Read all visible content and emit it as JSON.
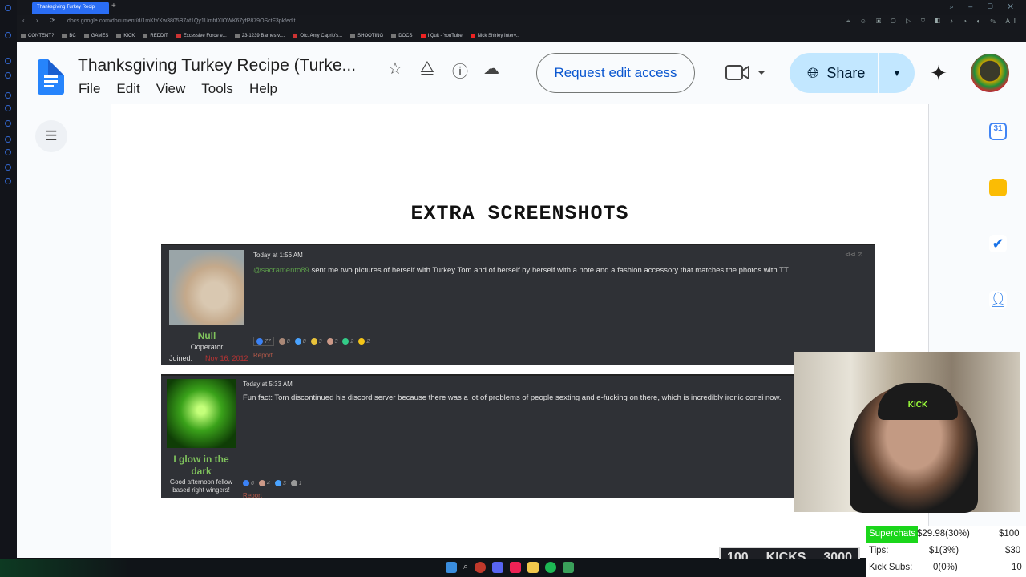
{
  "browser": {
    "tab_title": "Thanksgiving Turkey Recip",
    "url": "docs.google.com/document/d/1mKfYKw3805B7af1Qy1UmfdXlOWK67yfP879OSctF3pk/edit",
    "bookmarks": [
      "CONTENT?",
      "BC",
      "GAMES",
      "KICK",
      "REDDIT",
      "Excessive Force e...",
      "23-1239 Barnes v....",
      "Ofc. Amy Caprio's...",
      "SHOOTING",
      "DOCS",
      "I Quit - YouTube",
      "Nick Shirley Interv..."
    ]
  },
  "docs": {
    "title": "Thanksgiving Turkey Recipe (Turke...",
    "menu": [
      "File",
      "Edit",
      "View",
      "Tools",
      "Help"
    ],
    "request_edit": "Request edit access",
    "share": "Share",
    "heading": "EXTRA SCREENSHOTS"
  },
  "posts": [
    {
      "timestamp": "Today at 1:56 AM",
      "mention": "@sacramento89",
      "text": " sent me two pictures of herself with Turkey Tom and of herself by herself with a note and a fashion accessory that matches the photos with TT.",
      "username": "Null",
      "role": "Ooperator",
      "joined_label": "Joined:",
      "joined_date": "Nov 16, 2012",
      "report": "Report",
      "reactions": [
        "77",
        "8",
        "8",
        "3",
        "3",
        "2",
        "2"
      ]
    },
    {
      "timestamp": "Today at 5:33 AM",
      "text": "Fun fact: Tom discontinued his discord server because there was a lot of problems of people sexting and e-fucking on there, which is incredibly ironic consi now.",
      "username": "I glow in the dark",
      "role": "Good afternoon fellow based right wingers!",
      "report": "Report",
      "reactions": [
        "6",
        "4",
        "3",
        "1"
      ]
    }
  ],
  "webcam": {
    "hat_text": "KICK"
  },
  "overlay": {
    "kicks_low": "100",
    "kicks_label": "KICKS",
    "kicks_high": "3000",
    "stats": [
      {
        "label": "Superchats",
        "value": "$29.98(30%)",
        "goal": "$100"
      },
      {
        "label": "Tips:",
        "value": "$1(3%)",
        "goal": "$30"
      },
      {
        "label": "Kick Subs:",
        "value": "0(0%)",
        "goal": "10"
      }
    ]
  },
  "colors": {
    "accent": "#0b57d0",
    "share_bg": "#c2e7ff",
    "username_green": "#7fc25c",
    "superchat_green": "#1bd61b"
  }
}
